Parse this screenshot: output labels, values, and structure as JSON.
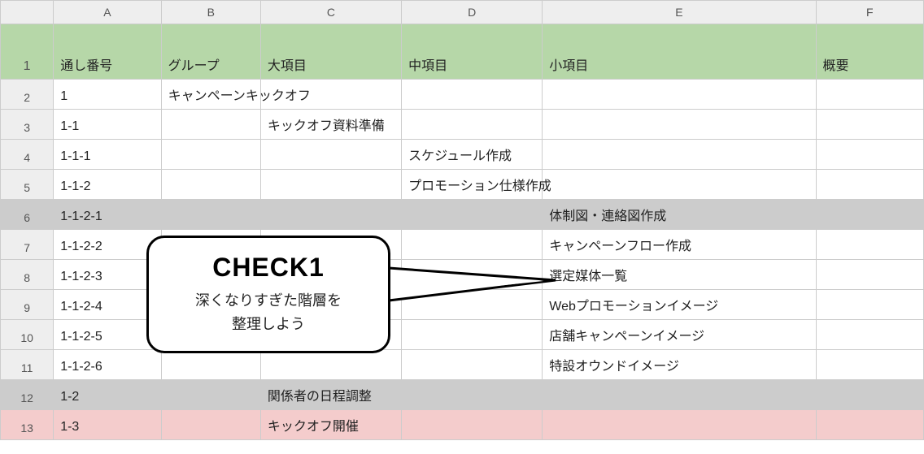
{
  "columns": [
    "A",
    "B",
    "C",
    "D",
    "E",
    "F"
  ],
  "header": {
    "A": "通し番号",
    "B": "グループ",
    "C": "大項目",
    "D": "中項目",
    "E": "小項目",
    "F": "概要"
  },
  "rows": [
    {
      "n": "1",
      "fill": "header"
    },
    {
      "n": "2",
      "A": "1",
      "B": "キャンペーンキックオフ"
    },
    {
      "n": "3",
      "A": "1-1",
      "C": "キックオフ資料準備"
    },
    {
      "n": "4",
      "A": "1-1-1",
      "D": "スケジュール作成"
    },
    {
      "n": "5",
      "A": "1-1-2",
      "D": "プロモーション仕様作成"
    },
    {
      "n": "6",
      "A": "1-1-2-1",
      "E": "体制図・連絡図作成",
      "fill": "gray"
    },
    {
      "n": "7",
      "A": "1-1-2-2",
      "E": "キャンペーンフロー作成"
    },
    {
      "n": "8",
      "A": "1-1-2-3",
      "E": "選定媒体一覧"
    },
    {
      "n": "9",
      "A": "1-1-2-4",
      "E": "Webプロモーションイメージ"
    },
    {
      "n": "10",
      "A": "1-1-2-5",
      "E": "店舗キャンペーンイメージ"
    },
    {
      "n": "11",
      "A": "1-1-2-6",
      "E": "特設オウンドイメージ"
    },
    {
      "n": "12",
      "A": "1-2",
      "C": "関係者の日程調整",
      "fill": "gray"
    },
    {
      "n": "13",
      "A": "1-3",
      "C": "キックオフ開催",
      "fill": "pink"
    }
  ],
  "callout": {
    "title": "CHECK1",
    "subtitle_line1": "深くなりすぎた階層を",
    "subtitle_line2": "整理しよう"
  }
}
